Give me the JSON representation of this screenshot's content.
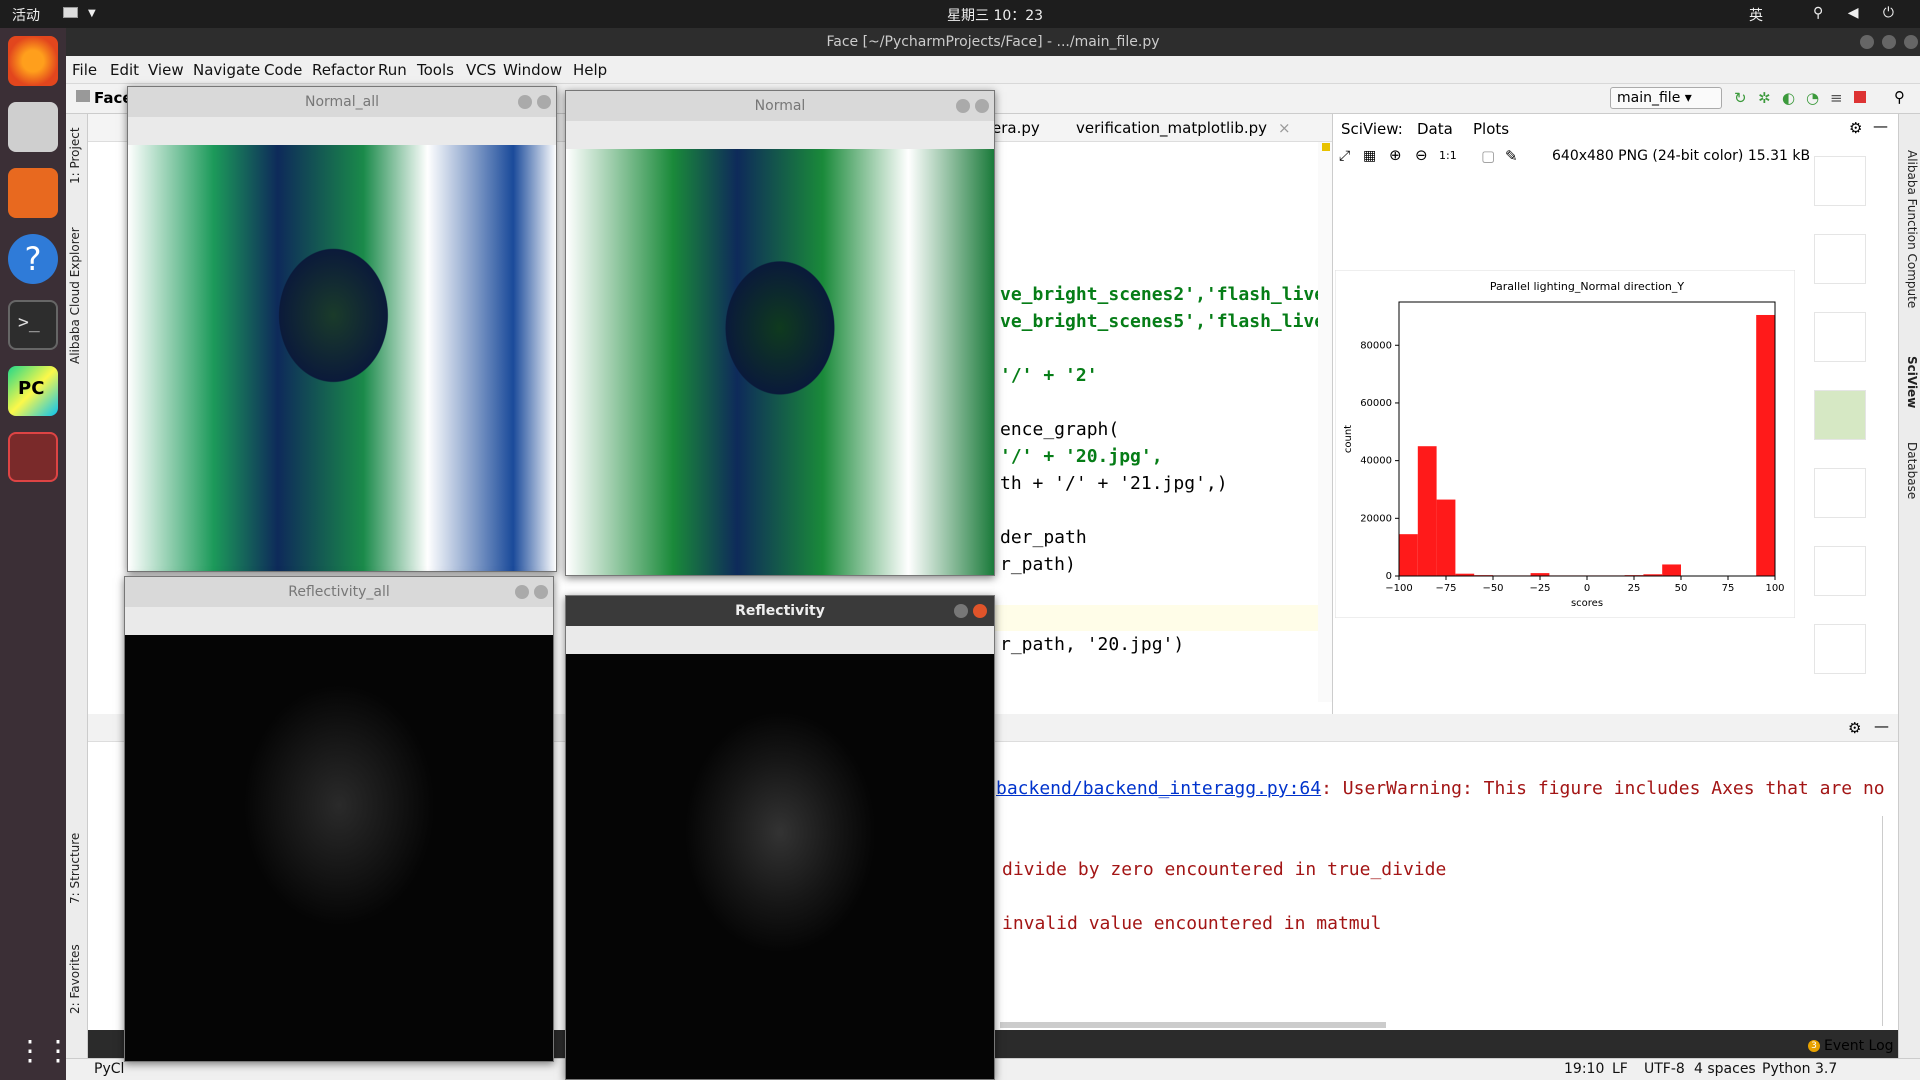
{
  "topbar": {
    "activities": "活动",
    "clock": "星期三 10：23",
    "ime": "英",
    "tray": "⚲ ◀ ⏻"
  },
  "window": {
    "title": "Face [~/PycharmProjects/Face] - .../main_file.py"
  },
  "menu": [
    "File",
    "Edit",
    "View",
    "Navigate",
    "Code",
    "Refactor",
    "Run",
    "Tools",
    "VCS",
    "Window",
    "Help"
  ],
  "toolbar": {
    "project": "Face",
    "run_config": "main_file"
  },
  "left_tools": {
    "project": "1: Project",
    "cloud": "Alibaba Cloud Explorer",
    "structure": "7: Structure",
    "favorites": "2: Favorites",
    "run": "Run"
  },
  "right_tools": {
    "alibaba": "Alibaba Function Compute",
    "sciview": "SciView",
    "database": "Database"
  },
  "tabs": [
    {
      "label": "era.py"
    },
    {
      "label": "verification_matplotlib.py"
    }
  ],
  "code_lines": [
    {
      "pre": "ve_bright_scenes2','flash_live_",
      "str": ""
    },
    {
      "pre": "ve_bright_scenes5','flash_live_",
      "str": ""
    },
    {
      "pre": "'/' + '2'",
      "str": ""
    },
    {
      "pre": "ence_graph(",
      "str": ""
    },
    {
      "pre": "'/' + '20.jpg',",
      "str": ""
    },
    {
      "pre": "th + '/' + '21.jpg',)",
      "str": ""
    },
    {
      "pre": "der_path",
      "str": ""
    },
    {
      "pre": "r_path)",
      "str": ""
    },
    {
      "pre": "r_path, '20.jpg')",
      "str": ""
    }
  ],
  "sciview": {
    "tabs": [
      "SciView:",
      "Data",
      "Plots"
    ],
    "info": "640x480 PNG (24-bit color) 15.31 kB"
  },
  "chart_data": {
    "type": "bar",
    "title": "Parallel lighting_Normal direction_Y",
    "xlabel": "scores",
    "ylabel": "count",
    "xlim": [
      -100,
      100
    ],
    "ylim": [
      0,
      95000
    ],
    "xticks": [
      "−100",
      "−75",
      "−50",
      "−25",
      "0",
      "25",
      "50",
      "75",
      "100"
    ],
    "yticks": [
      "0",
      "20000",
      "40000",
      "60000",
      "80000"
    ],
    "bins": [
      -100,
      -90,
      -80,
      -70,
      -60,
      -50,
      -40,
      -30,
      -20,
      -10,
      0,
      10,
      20,
      30,
      40,
      50,
      60,
      70,
      80,
      90,
      100
    ],
    "values": [
      14500,
      45000,
      26500,
      800,
      300,
      200,
      200,
      1000,
      200,
      200,
      200,
      200,
      300,
      600,
      4000,
      100,
      100,
      100,
      100,
      90500
    ],
    "bar_color": "#ff1a1a"
  },
  "run_output": [
    {
      "text": "backend/backend_interagg.py:64",
      "rest": ": UserWarning: This figure includes Axes that are no"
    },
    {
      "text": "",
      "rest": "divide by zero encountered in true_divide"
    },
    {
      "text": "",
      "rest": "invalid value encountered in matmul"
    }
  ],
  "statusbar": {
    "left": "PyCl",
    "pos": "19:10",
    "lf": "LF",
    "enc": "UTF-8",
    "indent": "4 spaces",
    "python": "Python 3.7",
    "eventlog": "Event Log",
    "eventcount": "3"
  },
  "cv_windows": {
    "normal_all": "Normal_all",
    "normal": "Normal",
    "refl_all": "Reflectivity_all",
    "refl": "Reflectivity"
  }
}
